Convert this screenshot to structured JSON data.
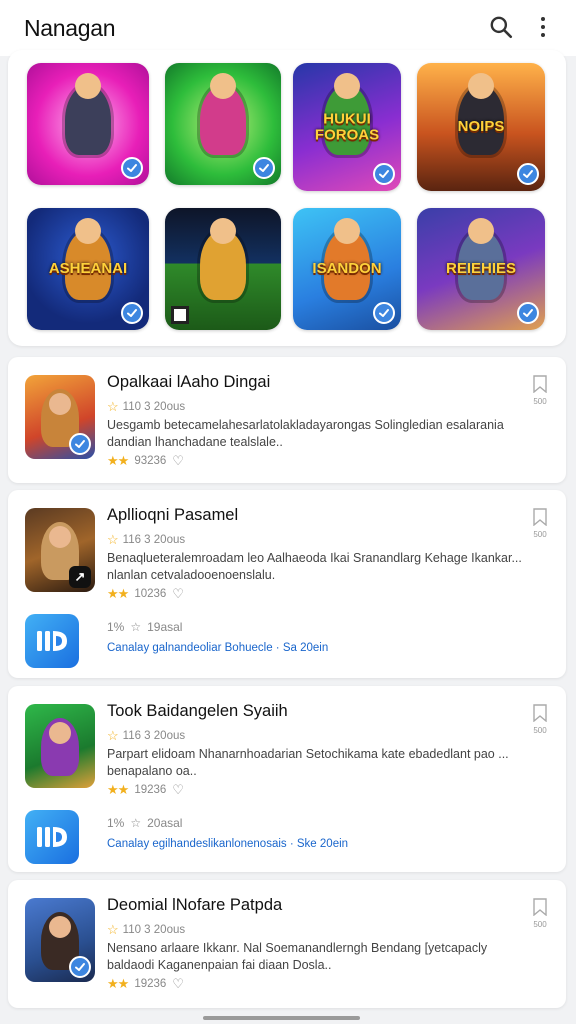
{
  "app": {
    "title": "Nanagan"
  },
  "icons": {
    "search": "search-icon",
    "more": "more-vert-icon"
  },
  "tiles": [
    {
      "label": "",
      "bg": "radial-gradient(circle at 50% 50%,#ffb3f0,#e81fb8 60%,#b0109a)",
      "fig": "#3c3f5a",
      "badge": "check"
    },
    {
      "label": "",
      "bg": "radial-gradient(circle at 50% 50%,#b9f07a,#2ebd3b 60%,#137a2a)",
      "fig": "#d23c8b",
      "badge": "check"
    },
    {
      "label": "HUKUI FOROAS",
      "bg": "linear-gradient(160deg,#2637a8,#8a2ed1 55%,#e04ab8)",
      "fig": "#3e9b37",
      "badge": "check"
    },
    {
      "label": "NOIPS",
      "bg": "linear-gradient(180deg,#ffb24a,#c9541f 55%,#5a2410)",
      "fig": "#2c2a33",
      "badge": "check"
    },
    {
      "label": "ASHEANAI",
      "bg": "radial-gradient(circle at 50% 40%,#2c5bd0,#132a7a 70%)",
      "fig": "#d88a2a",
      "badge": "check"
    },
    {
      "label": "",
      "bg": "linear-gradient(180deg,#0e1528 0%,#123060 45%,#2f8a2a 46%,#1c5a18 100%)",
      "fig": "#e0a232",
      "badge": "square"
    },
    {
      "label": "ISANDON",
      "bg": "linear-gradient(160deg,#3ec3f5,#2a7fe0 60%,#1a4fa0)",
      "fig": "#e27a2a",
      "badge": "check"
    },
    {
      "label": "REIEHIES",
      "bg": "linear-gradient(160deg,#3a3fa8,#7a3ac0 50%,#e0a050)",
      "fig": "#5a6f9a",
      "badge": "check"
    }
  ],
  "apps": [
    {
      "title": "Opalkaai lAaho Dingai",
      "meta": "110 3 20ous",
      "desc": "Uesgamb betecamelahesarlatolakladayarongas Solingledian esalarania dandian lhanchadane tealslale..",
      "rating": "93236",
      "bookmark_text": "500",
      "icon_bg": "linear-gradient(160deg,#f2a43a,#d0452a 60%,#2a4fa8)",
      "icon_fig": "#c8843a",
      "icon_badge": "blue"
    },
    {
      "title": "Apllioqni Pasamel",
      "meta": "116 3 20ous",
      "desc": "Benaqlueteralemroadam leo Aalhaeoda Ikai Sranandlarg Kehage Ikankar... nlanlan cetvaladooenoenslalu.",
      "rating": "10236",
      "bookmark_text": "500",
      "icon_bg": "linear-gradient(160deg,#5a3a22,#a0652a 50%,#2a1a10)",
      "icon_fig": "#c99a60",
      "icon_badge": "dark",
      "promo": {
        "meta_a": "1%",
        "meta_b": "19asal",
        "link": "Canalay galnandeoliar Bohuecle",
        "link_b": "Sa 20ein"
      }
    },
    {
      "title": "Took Baidangelen Syaiih",
      "meta": "116 3 20ous",
      "desc": "Parpart elidoam Nhanarnhoadarian Setochikama kate ebadedlant pao ... benapalano oa..",
      "rating": "19236",
      "bookmark_text": "500",
      "icon_bg": "linear-gradient(160deg,#2fb84a,#1b7a2e 60%,#e0a03a)",
      "icon_fig": "#8a3ab0",
      "icon_badge": "none",
      "promo": {
        "meta_a": "1%",
        "meta_b": "20asal",
        "link": "Canalay egilhandeslikanlonenosais",
        "link_b": "Ske 20ein"
      }
    },
    {
      "title": "Deomial lNofare Patpda",
      "meta": "110 3 20ous",
      "desc": "Nensano arlaare Ikkanr. Nal Soemanandlerngh Bendang [yetcapacly baldaodi Kaganenpaian fai diaan Dosla..",
      "rating": "19236",
      "bookmark_text": "500",
      "icon_bg": "linear-gradient(160deg,#4a7ad0,#2a4f90 60%,#1a2a50)",
      "icon_fig": "#3a2a24",
      "icon_badge": "blue"
    }
  ]
}
